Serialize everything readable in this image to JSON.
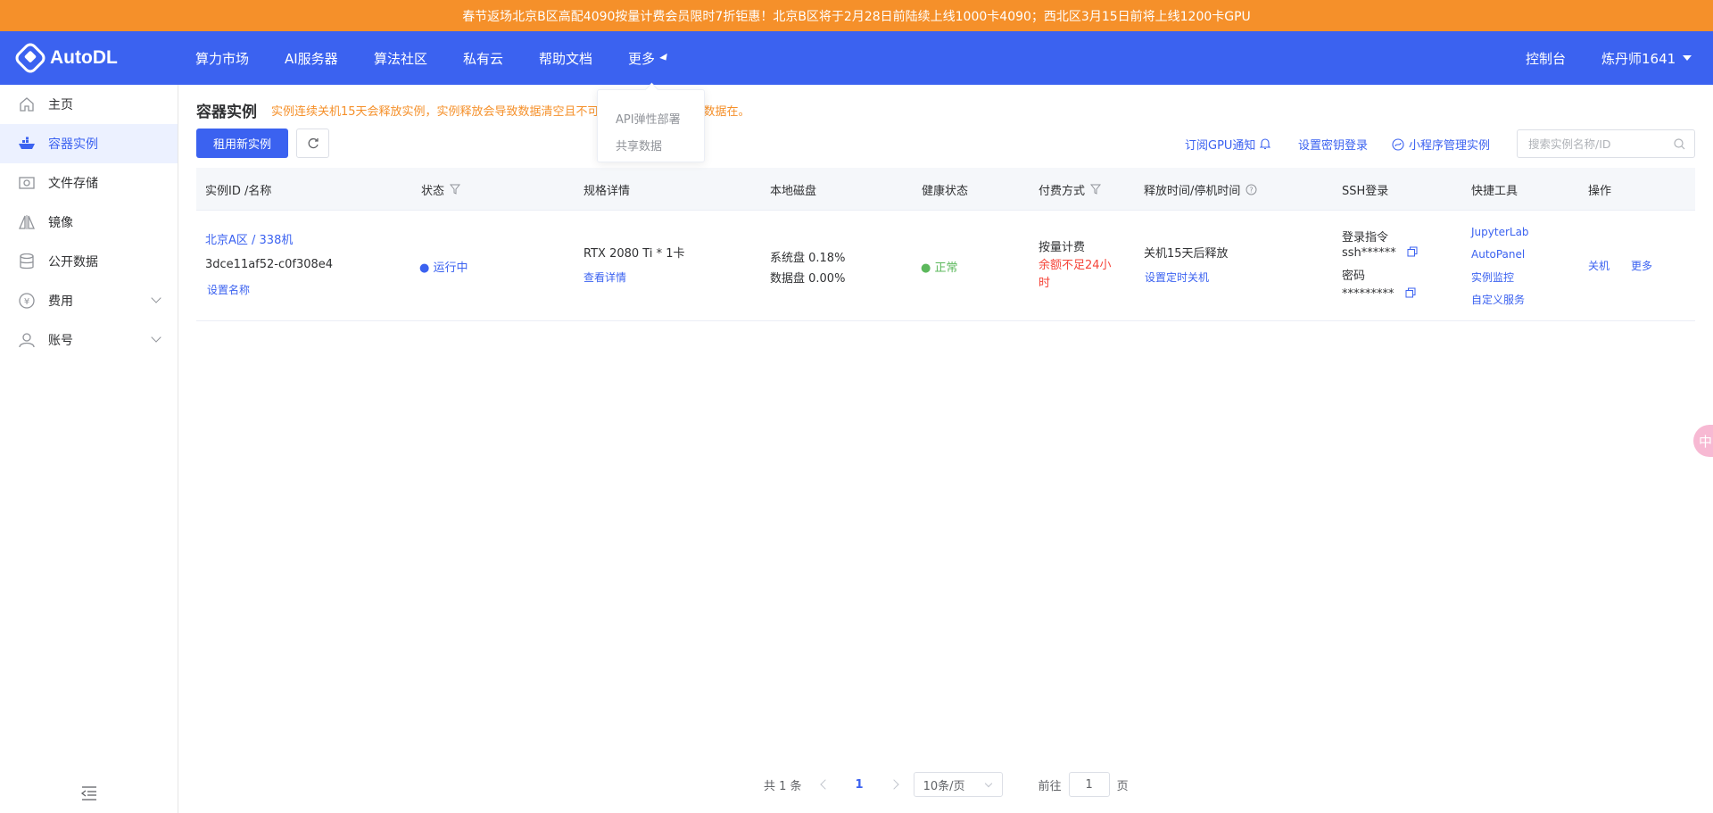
{
  "banner": {
    "text": "春节返场北京B区高配4090按量计费会员限时7折钜惠！北京B区将于2月28日前陆续上线1000卡4090；西北区3月15日前将上线1200卡GPU"
  },
  "brand": {
    "name": "AutoDL"
  },
  "nav": {
    "items": [
      "算力市场",
      "AI服务器",
      "算法社区",
      "私有云",
      "帮助文档",
      "更多"
    ],
    "console": "控制台",
    "user": "炼丹师1641"
  },
  "more_menu": {
    "items": [
      "API弹性部署",
      "共享数据"
    ]
  },
  "sidebar": {
    "items": [
      {
        "label": "主页",
        "icon": "home-icon"
      },
      {
        "label": "容器实例",
        "icon": "container-icon"
      },
      {
        "label": "文件存储",
        "icon": "storage-icon"
      },
      {
        "label": "镜像",
        "icon": "image-icon"
      },
      {
        "label": "公开数据",
        "icon": "database-icon"
      },
      {
        "label": "费用",
        "icon": "yuan-icon"
      },
      {
        "label": "账号",
        "icon": "user-icon"
      }
    ]
  },
  "page": {
    "title": "容器实例",
    "tip": "实例连续关机15天会释放实例，实例释放会导致数据清空且不可恢复，释放前实例在数据在。",
    "new_instance": "租用新实例",
    "subscribe_gpu": "订阅GPU通知",
    "set_key_login": "设置密钥登录",
    "mini_program": "小程序管理实例",
    "search_placeholder": "搜索实例名称/ID"
  },
  "table": {
    "headers": [
      "实例ID /名称",
      "状态",
      "规格详情",
      "本地磁盘",
      "健康状态",
      "付费方式",
      "释放时间/停机时间",
      "SSH登录",
      "快捷工具",
      "操作"
    ],
    "rows": [
      {
        "region_name": "北京A区 / 338机",
        "id": "3dce11af52-c0f308e4",
        "set_name": "设置名称",
        "status": "运行中",
        "spec": "RTX 2080 Ti * 1卡",
        "view_details": "查看详情",
        "system_disk": "系统盘 0.18%",
        "data_disk": "数据盘 0.00%",
        "health": "正常",
        "billing": "按量计费",
        "balance_warning_line1": "余额不足24小",
        "balance_warning_line2": "时",
        "release": "关机15天后释放",
        "set_timed_shutdown": "设置定时关机",
        "ssh_cmd_label": "登录指令",
        "ssh_cmd": "ssh******",
        "password_label": "密码",
        "password": "*********",
        "tools": [
          "JupyterLab",
          "AutoPanel",
          "实例监控",
          "自定义服务"
        ],
        "action_shutdown": "关机",
        "action_more": "更多"
      }
    ]
  },
  "pagination": {
    "total": "共 1 条",
    "current_page": "1",
    "page_size": "10条/页",
    "goto_prefix": "前往",
    "goto_value": "1",
    "goto_suffix": "页"
  },
  "float_bubble": {
    "text": "中"
  },
  "colors": {
    "primary": "#3b62f0",
    "banner": "#f5902a",
    "success": "#5cb85c",
    "danger": "#f5453a"
  }
}
